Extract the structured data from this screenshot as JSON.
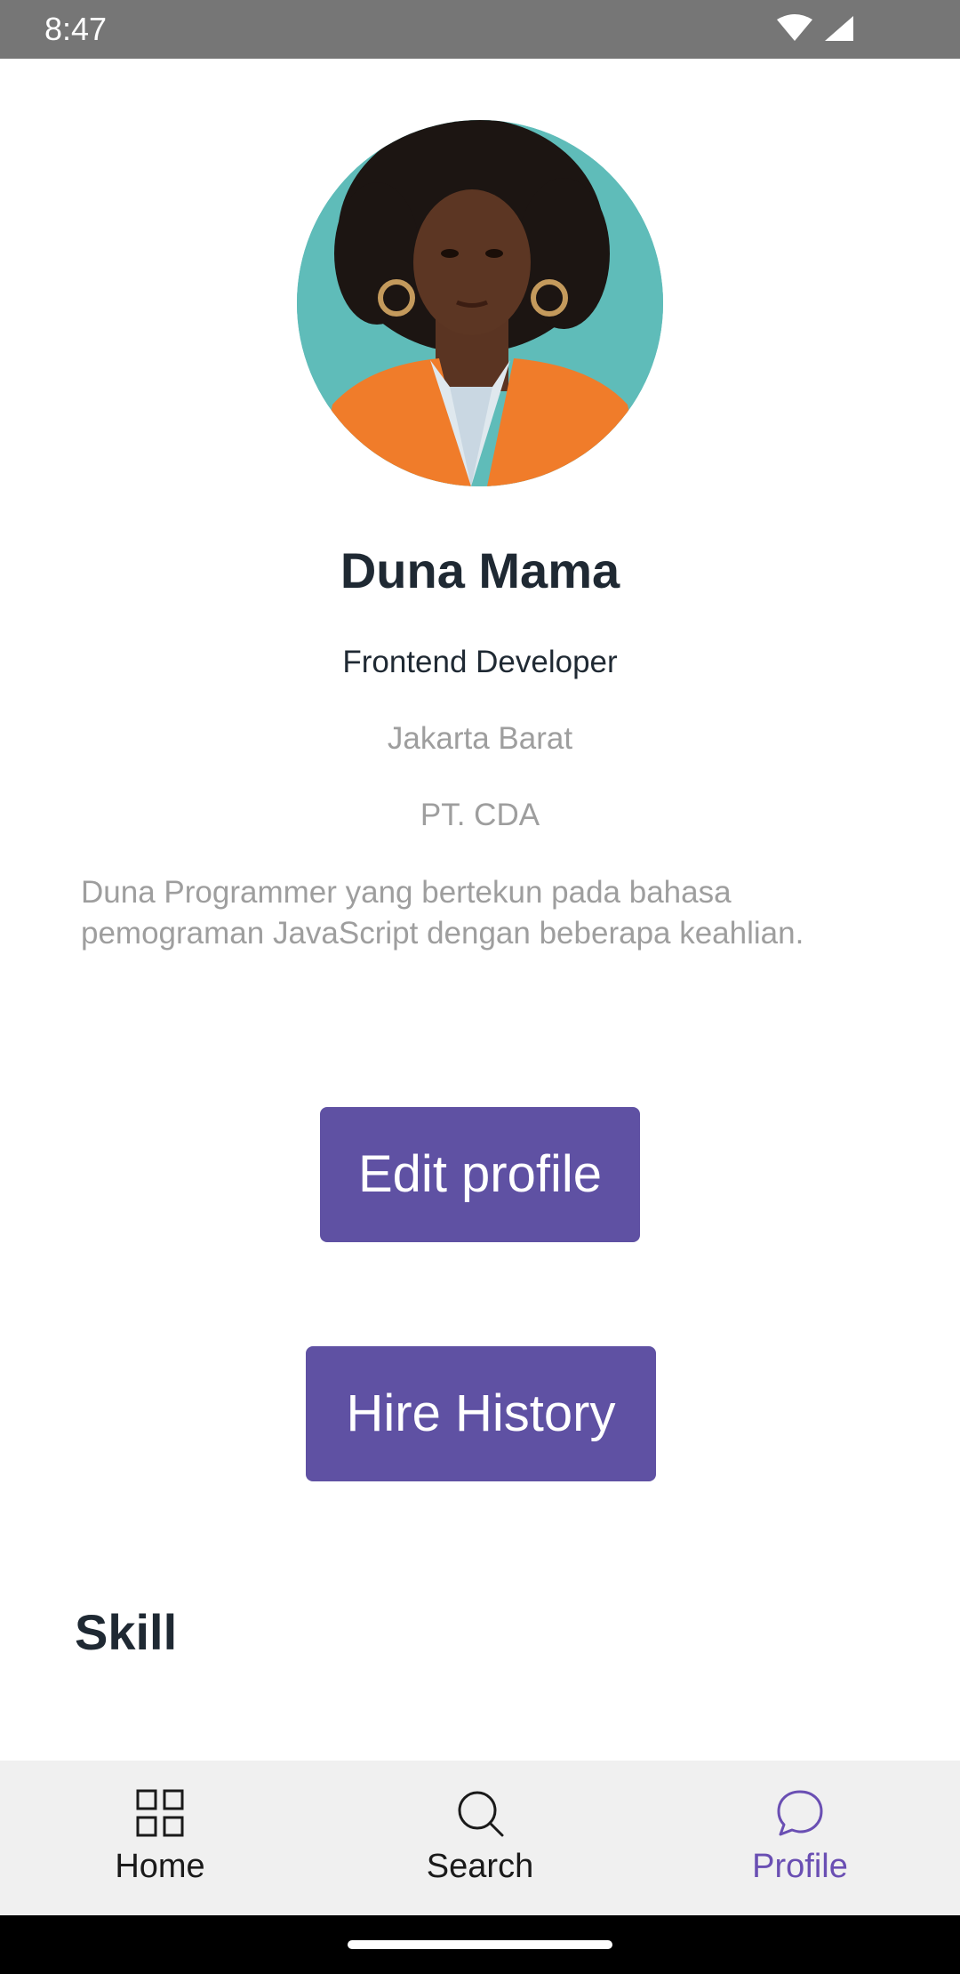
{
  "status_bar": {
    "time": "8:47",
    "icons": [
      "wifi-icon",
      "signal-icon"
    ]
  },
  "profile": {
    "name": "Duna Mama",
    "role": "Frontend Developer",
    "location": "Jakarta Barat",
    "company": "PT. CDA",
    "bio_line_1": "Duna Programmer yang bertekun pada bahasa",
    "bio_line_2": "pemograman JavaScript dengan beberapa keahlian."
  },
  "actions": {
    "edit_profile_label": "Edit profile",
    "hire_history_label": "Hire History"
  },
  "sections": {
    "skill_heading": "Skill"
  },
  "bottom_nav": {
    "items": [
      {
        "label": "Home",
        "icon": "grid-icon",
        "active": false
      },
      {
        "label": "Search",
        "icon": "search-icon",
        "active": false
      },
      {
        "label": "Profile",
        "icon": "chat-bubble-icon",
        "active": true
      }
    ]
  },
  "colors": {
    "primary_button": "#5f51a3",
    "active_nav": "#6a4fb3",
    "status_bar": "#767676",
    "muted_text": "#9e9e9e",
    "heading_text": "#1f2933",
    "avatar_background": "#5fbcb9"
  }
}
